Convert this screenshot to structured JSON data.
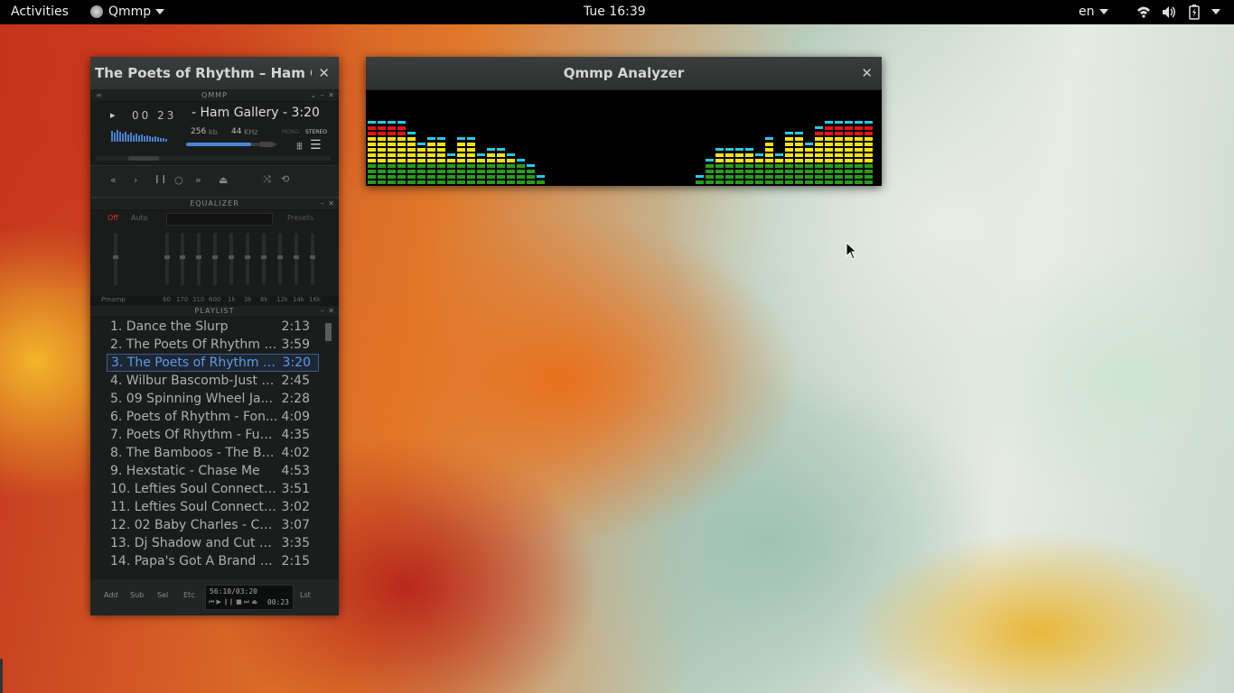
{
  "topbar": {
    "activities": "Activities",
    "app_name": "Qmmp",
    "clock": "Tue 16:39",
    "lang": "en",
    "icons": [
      "wifi-icon",
      "volume-icon",
      "battery-icon",
      "power-menu-icon"
    ]
  },
  "player": {
    "window_title": "The Poets of Rhythm – Ham Ga...",
    "skin_title": "QMMP",
    "time": "00 23",
    "track": "- Ham Gallery - 3:20",
    "bitrate": "256",
    "bitrate_unit": "kb",
    "samplerate": "44",
    "samplerate_unit": "KHz",
    "mono": "MONO",
    "stereo": "STEREO",
    "volume_fraction": 0.72,
    "controls": [
      "«",
      "›",
      "॥",
      "○",
      "»",
      "⏏"
    ],
    "shuffle": "⤨",
    "repeat": "⟲"
  },
  "equalizer": {
    "header": "EQUALIZER",
    "off": "Off",
    "auto": "Auto",
    "presets": "Presets",
    "preamp": "Preamp",
    "bands": [
      "60",
      "170",
      "310",
      "600",
      "1k",
      "3k",
      "6k",
      "12k",
      "14k",
      "16k"
    ]
  },
  "playlist": {
    "header": "PLAYLIST",
    "items": [
      {
        "title": "1. Dance the Slurp",
        "duration": "2:13"
      },
      {
        "title": "2. The Poets Of Rhythm -...",
        "duration": "3:59"
      },
      {
        "title": "3. The Poets of Rhythm - ...",
        "duration": "3:20",
        "selected": true
      },
      {
        "title": "4. Wilbur Bascomb-Just A...",
        "duration": "2:45"
      },
      {
        "title": "5. 09 Spinning Wheel Ja...",
        "duration": "2:28"
      },
      {
        "title": "6. Poets of Rhythm - Fon...",
        "duration": "4:09"
      },
      {
        "title": "7. Poets Of Rhythm - Fun...",
        "duration": "4:35"
      },
      {
        "title": "8. The Bamboos - The Ba...",
        "duration": "4:02"
      },
      {
        "title": "9. Hexstatic - Chase Me",
        "duration": "4:53"
      },
      {
        "title": "10. Lefties Soul Connecti...",
        "duration": "3:51"
      },
      {
        "title": "11. Lefties Soul Connecti...",
        "duration": "3:02"
      },
      {
        "title": "12. 02 Baby Charles - Co...",
        "duration": "3:07"
      },
      {
        "title": "13. Dj Shadow and Cut C...",
        "duration": "3:35"
      },
      {
        "title": "14. Papa's Got A Brand N...",
        "duration": "2:15"
      }
    ],
    "buttons": {
      "add": "Add",
      "sub": "Sub",
      "sel": "Sel",
      "etc": "Etc",
      "lst": "Lst"
    },
    "total_time": "56:10/03:20",
    "mini_time": "00:23"
  },
  "analyzer": {
    "window_title": "Qmmp Analyzer",
    "levels": [
      11,
      11,
      11,
      11,
      9,
      7,
      8,
      8,
      5,
      8,
      8,
      5,
      6,
      6,
      5,
      4,
      3,
      1,
      0,
      0,
      0,
      0,
      0,
      0,
      0,
      0,
      0,
      0,
      0,
      0,
      0,
      0,
      0,
      1,
      4,
      6,
      6,
      6,
      6,
      5,
      8,
      5,
      9,
      9,
      7,
      10,
      11,
      11,
      11,
      11,
      11
    ],
    "colors": {
      "low": "#2a9b1e",
      "mid": "#f3e21c",
      "high": "#e01616",
      "peak": "#28c9e6"
    }
  }
}
